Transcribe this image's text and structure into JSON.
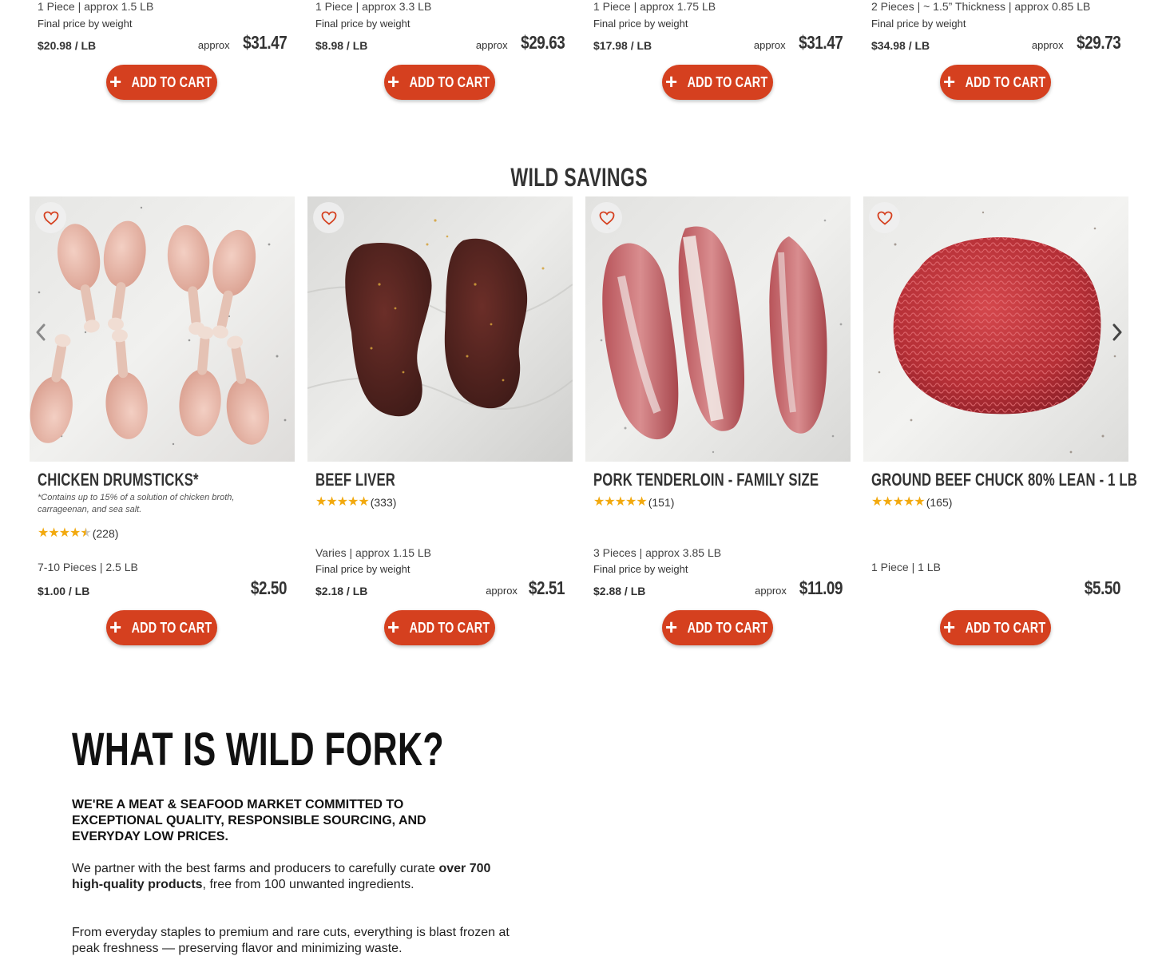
{
  "top_row": [
    {
      "meta": "1 Piece | approx 1.5 LB",
      "final_note": "Final price by weight",
      "per_lb": "$20.98 / LB",
      "approx_label": "approx",
      "price": "$31.47",
      "cta": "ADD TO CART"
    },
    {
      "meta": "1 Piece | approx 3.3 LB",
      "final_note": "Final price by weight",
      "per_lb": "$8.98 / LB",
      "approx_label": "approx",
      "price": "$29.63",
      "cta": "ADD TO CART"
    },
    {
      "meta": "1 Piece | approx 1.75 LB",
      "final_note": "Final price by weight",
      "per_lb": "$17.98 / LB",
      "approx_label": "approx",
      "price": "$31.47",
      "cta": "ADD TO CART"
    },
    {
      "meta": "2 Pieces | ~ 1.5” Thickness | approx 0.85 LB",
      "final_note": "Final price by weight",
      "per_lb": "$34.98 / LB",
      "approx_label": "approx",
      "price": "$29.73",
      "cta": "ADD TO CART"
    }
  ],
  "section_title": "WILD SAVINGS",
  "products": [
    {
      "name": "CHICKEN DRUMSTICKS*",
      "note": "*Contains up to 15% of a solution of chicken broth, carrageenan, and sea salt.",
      "rating": 4.5,
      "rating_count": "(228)",
      "meta": "7-10 Pieces | 2.5 LB",
      "final_note": "",
      "per_lb": "$1.00 / LB",
      "approx_label": "",
      "price": "$2.50",
      "cta": "ADD TO CART"
    },
    {
      "name": "BEEF LIVER",
      "note": "",
      "rating": 4.8,
      "rating_count": "(333)",
      "meta": "Varies | approx 1.15 LB",
      "final_note": "Final price by weight",
      "per_lb": "$2.18 / LB",
      "approx_label": "approx",
      "price": "$2.51",
      "cta": "ADD TO CART"
    },
    {
      "name": "PORK TENDERLOIN - FAMILY SIZE",
      "note": "",
      "rating": 4.8,
      "rating_count": "(151)",
      "meta": "3 Pieces | approx 3.85 LB",
      "final_note": "Final price by weight",
      "per_lb": "$2.88 / LB",
      "approx_label": "approx",
      "price": "$11.09",
      "cta": "ADD TO CART"
    },
    {
      "name": "GROUND BEEF CHUCK 80% LEAN - 1 LB",
      "note": "",
      "rating": 4.8,
      "rating_count": "(165)",
      "meta": "1 Piece | 1 LB",
      "final_note": "",
      "per_lb": "",
      "approx_label": "",
      "price": "$5.50",
      "cta": "ADD TO CART"
    }
  ],
  "carousel": {
    "prev_icon": "chevron-left-icon",
    "next_icon": "chevron-right-icon"
  },
  "about": {
    "title": "WHAT IS WILD FORK?",
    "lead": "We're a meat & seafood market committed to exceptional quality, responsible sourcing, and everyday low prices.",
    "p1_before": "We partner with the best farms and producers to carefully curate ",
    "p1_bold": "over 700 high-quality products",
    "p1_after": ", free from 100 unwanted ingredients.",
    "p2": "From everyday staples to premium and rare cuts, everything is blast frozen at peak freshness — preserving flavor and minimizing waste."
  },
  "colors": {
    "brand_red": "#d5401f",
    "star": "#f2a90e",
    "text": "#333333"
  }
}
